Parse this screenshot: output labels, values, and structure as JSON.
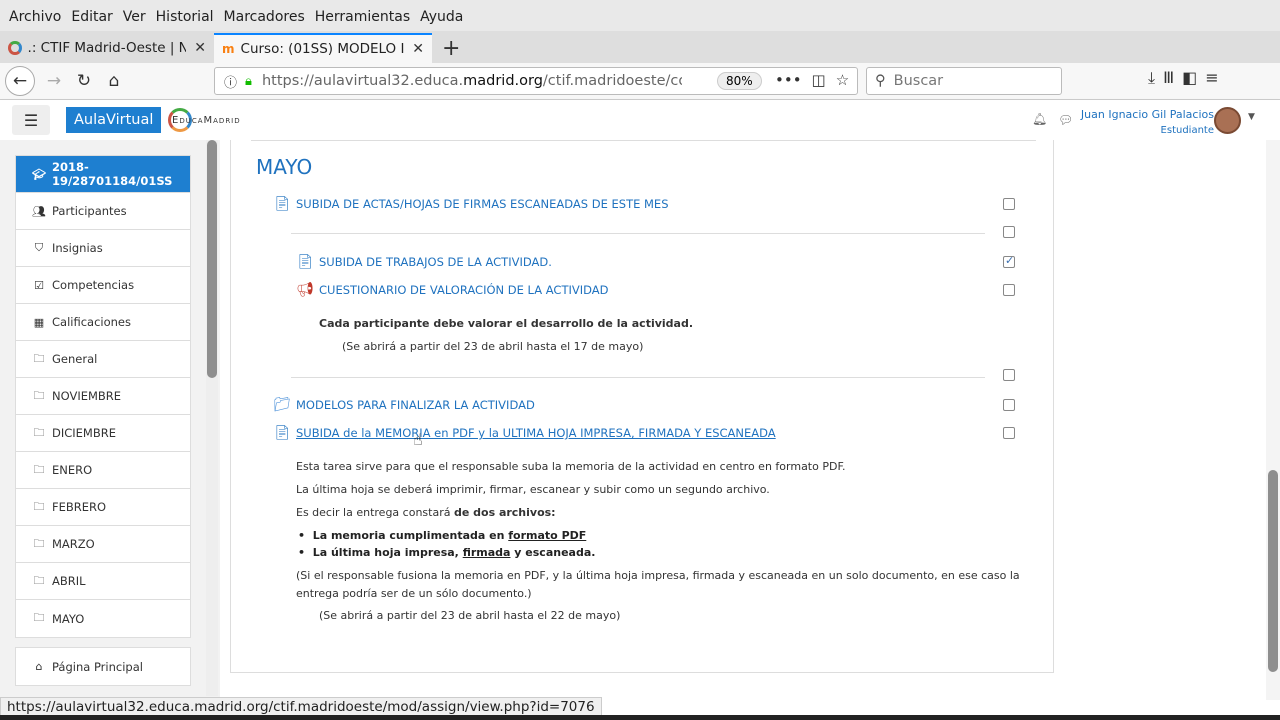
{
  "menu": [
    "Archivo",
    "Editar",
    "Ver",
    "Historial",
    "Marcadores",
    "Herramientas",
    "Ayuda"
  ],
  "tabs": [
    {
      "title": ".: CTIF Madrid-Oeste | Nc"
    },
    {
      "title": "Curso: (01SS) MODELO I"
    }
  ],
  "navbar": {
    "url_prefix": "https://aulavirtual32.educa.",
    "url_domain": "madrid.org",
    "url_rest": "/ctif.madridoeste/cours",
    "zoom": "80%",
    "search_placeholder": "Buscar"
  },
  "moodle": {
    "brand": "AulaVirtual",
    "logo_text": "EducaMadrid",
    "user_name": "Juan Ignacio Gil Palacios",
    "user_role": "Estudiante"
  },
  "drawer": {
    "items": [
      {
        "label": "2018-19/28701184/01SS",
        "icon": "graduation-cap-icon"
      },
      {
        "label": "Participantes",
        "icon": "users-icon"
      },
      {
        "label": "Insignias",
        "icon": "shield-icon"
      },
      {
        "label": "Competencias",
        "icon": "checkbox-icon"
      },
      {
        "label": "Calificaciones",
        "icon": "table-icon"
      },
      {
        "label": "General",
        "icon": "folder-icon"
      },
      {
        "label": "NOVIEMBRE",
        "icon": "folder-icon"
      },
      {
        "label": "DICIEMBRE",
        "icon": "folder-icon"
      },
      {
        "label": "ENERO",
        "icon": "folder-icon"
      },
      {
        "label": "FEBRERO",
        "icon": "folder-icon"
      },
      {
        "label": "MARZO",
        "icon": "folder-icon"
      },
      {
        "label": "ABRIL",
        "icon": "folder-icon"
      },
      {
        "label": "MAYO",
        "icon": "folder-icon"
      }
    ],
    "home": "Página Principal"
  },
  "section": {
    "title": "MAYO",
    "activities": [
      {
        "label": "SUBIDA DE ACTAS/HOJAS DE FIRMAS ESCANEADAS DE ESTE MES",
        "icon": "assignment-icon",
        "done": false
      },
      {
        "label": "SUBIDA DE TRABAJOS DE LA ACTIVIDAD.",
        "icon": "assignment-icon",
        "done": true
      },
      {
        "label": "CUESTIONARIO DE VALORACIÓN DE LA ACTIVIDAD",
        "icon": "feedback-megaphone-icon",
        "done": false
      },
      {
        "label": "MODELOS PARA FINALIZAR LA ACTIVIDAD",
        "icon": "folder-icon",
        "done": false
      },
      {
        "label": "SUBIDA de la MEMORIA en PDF y la ULTIMA HOJA IMPRESA, FIRMADA Y ESCANEADA",
        "icon": "assignment-icon",
        "done": false
      }
    ],
    "feedback_note": "Cada participante debe valorar el desarrollo de la actividad.",
    "feedback_dates": "(Se abrirá a partir del 23 de abril hasta el 17 de mayo)",
    "memoria": {
      "p1": "Esta tarea sirve para que el responsable suba la memoria de la actividad en centro en formato PDF.",
      "p2": "La última hoja se deberá imprimir, firmar, escanear y subir como un segundo archivo.",
      "p3_pre": "Es decir la entrega constará ",
      "p3_bold": "de dos archivos:",
      "b1_pre": "La memoria cumplimentada en ",
      "b1_link": "formato PDF",
      "b2_pre": "La última hoja impresa, ",
      "b2_link": "firmada",
      "b2_post": " y escaneada.",
      "p4a": "(Si el responsable fusiona la memoria en PDF, y la última hoja impresa, firmada y escaneada en un solo documento, en ese caso la",
      "p4b": "entrega podría ser de un sólo documento.)",
      "dates": "(Se abrirá a partir del 23 de abril hasta el 22 de mayo)"
    }
  },
  "status_url": "https://aulavirtual32.educa.madrid.org/ctif.madridoeste/mod/assign/view.php?id=7076"
}
